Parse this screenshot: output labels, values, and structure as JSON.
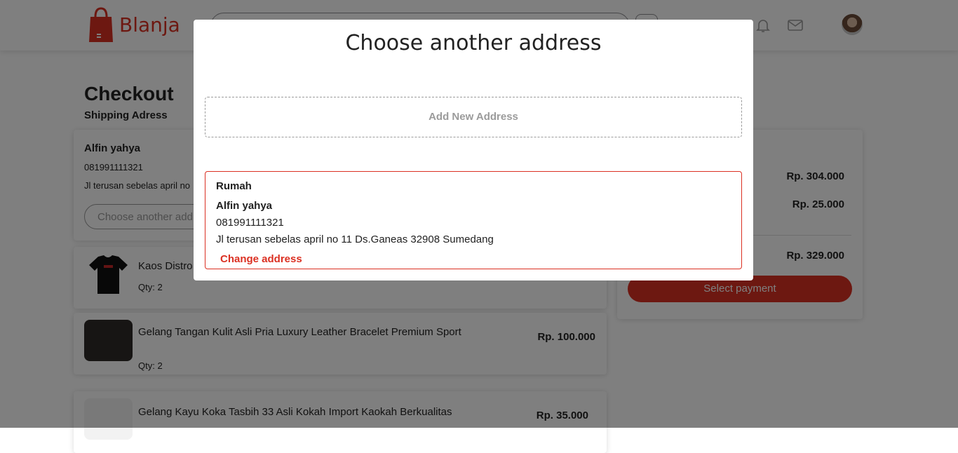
{
  "app": {
    "brand": "Blanja",
    "brand_color": "#db3022"
  },
  "navbar": {
    "icons": [
      "shopping-bag-icon",
      "cart-icon",
      "bell-icon",
      "mail-icon",
      "avatar"
    ]
  },
  "checkout": {
    "title": "Checkout",
    "subtitle": "Shipping Adress",
    "address": {
      "name": "Alfin yahya",
      "phone": "081991111321",
      "line_visible": "Jl terusan sebelas april no",
      "choose_label": "Choose another address"
    },
    "items": [
      {
        "name": "Kaos Distro",
        "qty": "Qty: 2",
        "price": ""
      },
      {
        "name": "Gelang Tangan Kulit Asli Pria Luxury Leather Bracelet Premium Sport",
        "qty": "Qty: 2",
        "price": "Rp. 100.000"
      },
      {
        "name": "Gelang Kayu Koka Tasbih 33 Asli Kokah Import Kaokah Berkualitas",
        "qty": "",
        "price": "Rp. 35.000"
      }
    ]
  },
  "summary": {
    "order_value": "Rp. 304.000",
    "delivery_value": "Rp. 25.000",
    "total_value": "Rp. 329.000",
    "pay_button": "Select payment"
  },
  "modal": {
    "title": "Choose another address",
    "add_new": "Add New Address",
    "selected_address": {
      "label": "Rumah",
      "name": "Alfin yahya",
      "phone": "081991111321",
      "line": "Jl terusan sebelas april no 11 Ds.Ganeas 32908 Sumedang",
      "change_label": "Change address"
    }
  }
}
